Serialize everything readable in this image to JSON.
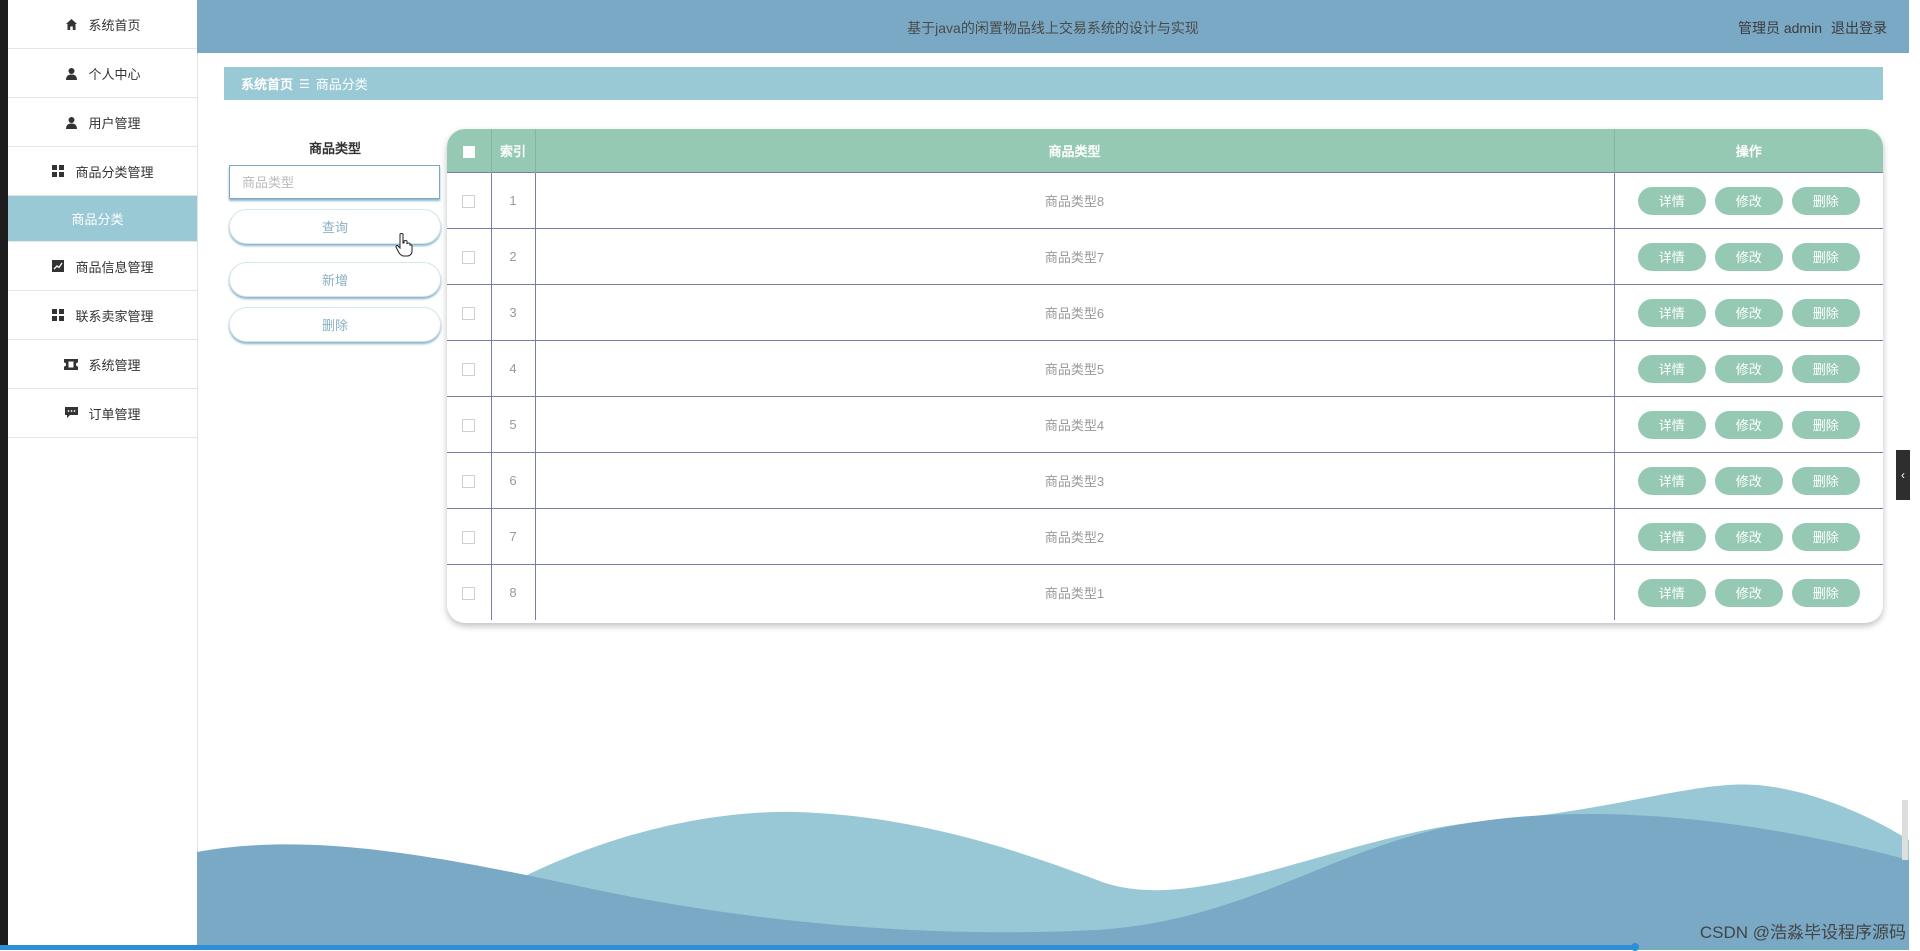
{
  "app": {
    "title": "基于java的闲置物品线上交易系统的设计与实现",
    "user_label": "管理员 admin",
    "logout_label": "退出登录"
  },
  "sidebar": {
    "items": [
      {
        "label": "系统首页",
        "icon": "home-icon"
      },
      {
        "label": "个人中心",
        "icon": "user-icon"
      },
      {
        "label": "用户管理",
        "icon": "user-icon"
      },
      {
        "label": "商品分类管理",
        "icon": "grid-icon"
      },
      {
        "label": "商品分类",
        "icon": ""
      },
      {
        "label": "商品信息管理",
        "icon": "chart-icon"
      },
      {
        "label": "联系卖家管理",
        "icon": "grid-icon"
      },
      {
        "label": "系统管理",
        "icon": "ticket-icon"
      },
      {
        "label": "订单管理",
        "icon": "comment-icon"
      }
    ]
  },
  "breadcrumb": {
    "home": "系统首页",
    "separator": "☰",
    "current": "商品分类"
  },
  "search": {
    "label": "商品类型",
    "placeholder": "商品类型",
    "query_button": "查询",
    "add_button": "新增",
    "delete_button": "删除"
  },
  "table": {
    "headers": {
      "index": "索引",
      "type": "商品类型",
      "ops": "操作"
    },
    "rows": [
      {
        "index": "1",
        "type": "商品类型8"
      },
      {
        "index": "2",
        "type": "商品类型7"
      },
      {
        "index": "3",
        "type": "商品类型6"
      },
      {
        "index": "4",
        "type": "商品类型5"
      },
      {
        "index": "5",
        "type": "商品类型4"
      },
      {
        "index": "6",
        "type": "商品类型3"
      },
      {
        "index": "7",
        "type": "商品类型2"
      },
      {
        "index": "8",
        "type": "商品类型1"
      }
    ],
    "row_buttons": {
      "detail": "详情",
      "edit": "修改",
      "delete": "删除"
    }
  },
  "watermark": "CSDN @浩淼毕设程序源码",
  "colors": {
    "header": "#79a9c4",
    "accent": "#9ac9d6",
    "table_head": "#96c9b4"
  }
}
